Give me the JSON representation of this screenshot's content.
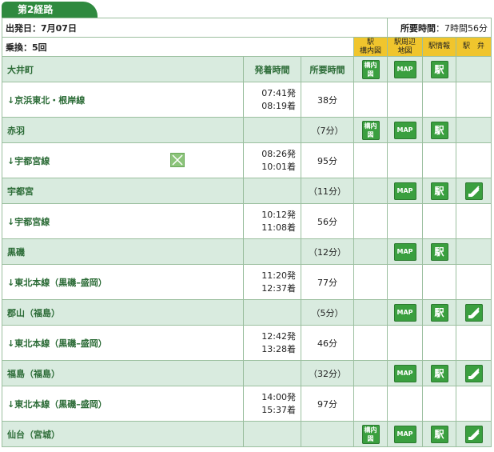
{
  "route_tab": "第2経路",
  "summary": {
    "departure": "出発日：7月07日",
    "total_label": "所要時間",
    "total_value": "：7時間56分",
    "transfer": "乗換：5回"
  },
  "column_headers": {
    "yard_map": "駅\n構内図",
    "area_map": "駅周辺\n地図",
    "station_info": "駅情報",
    "bento": "駅　弁",
    "time": "発着時間",
    "duration": "所要時間"
  },
  "button_labels": {
    "map": "MAP",
    "station": "駅",
    "yard": "構内\n図"
  },
  "rows": [
    {
      "type": "station",
      "name": "大井町",
      "duration": "",
      "yard": true,
      "map": true,
      "eki": true,
      "bento": false,
      "header": true
    },
    {
      "type": "segment",
      "line": "↓京浜東北・根岸線",
      "dep": "07:41発",
      "arr": "08:19着",
      "duration": "38分"
    },
    {
      "type": "station",
      "name": "赤羽",
      "duration": "（7分）",
      "yard": true,
      "map": true,
      "eki": true,
      "bento": false
    },
    {
      "type": "segment",
      "line": "↓宇都宮線",
      "dep": "08:26発",
      "arr": "10:01着",
      "duration": "95分",
      "icon": true
    },
    {
      "type": "station",
      "name": "宇都宮",
      "duration": "（11分）",
      "yard": false,
      "map": true,
      "eki": true,
      "bento": true
    },
    {
      "type": "segment",
      "line": "↓宇都宮線",
      "dep": "10:12発",
      "arr": "11:08着",
      "duration": "56分"
    },
    {
      "type": "station",
      "name": "黒磯",
      "duration": "（12分）",
      "yard": false,
      "map": true,
      "eki": true,
      "bento": false
    },
    {
      "type": "segment",
      "line": "↓東北本線（黒磯–盛岡）",
      "dep": "11:20発",
      "arr": "12:37着",
      "duration": "77分"
    },
    {
      "type": "station",
      "name": "郡山（福島）",
      "duration": "（5分）",
      "yard": false,
      "map": true,
      "eki": true,
      "bento": true
    },
    {
      "type": "segment",
      "line": "↓東北本線（黒磯–盛岡）",
      "dep": "12:42発",
      "arr": "13:28着",
      "duration": "46分"
    },
    {
      "type": "station",
      "name": "福島（福島）",
      "duration": "（32分）",
      "yard": false,
      "map": true,
      "eki": true,
      "bento": true
    },
    {
      "type": "segment",
      "line": "↓東北本線（黒磯–盛岡）",
      "dep": "14:00発",
      "arr": "15:37着",
      "duration": "97分"
    },
    {
      "type": "station",
      "name": "仙台（宮城）",
      "duration": "",
      "yard": true,
      "map": true,
      "eki": true,
      "bento": true
    }
  ]
}
